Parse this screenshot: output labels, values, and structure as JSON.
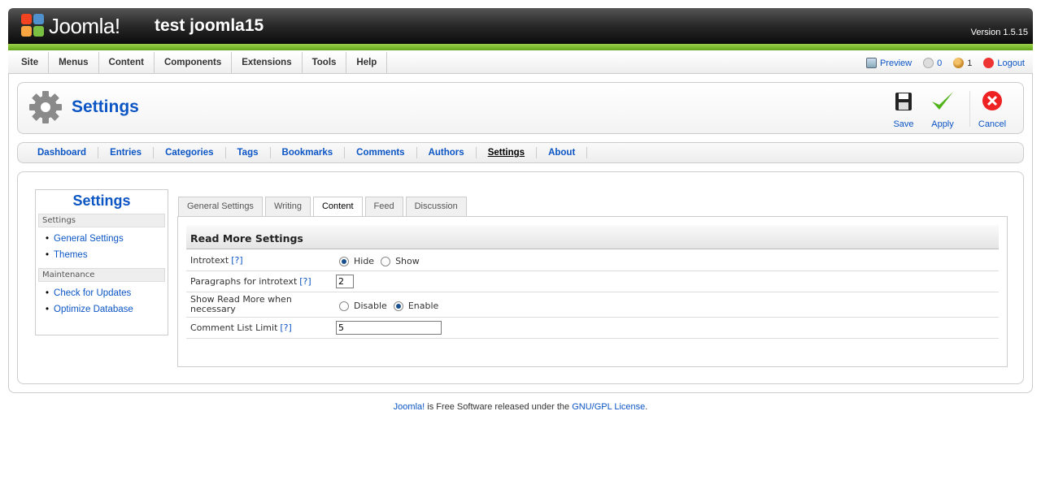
{
  "header": {
    "logo_text": "Joomla!",
    "site_name": "test joomla15",
    "version": "Version 1.5.15"
  },
  "menubar": {
    "items": [
      "Site",
      "Menus",
      "Content",
      "Components",
      "Extensions",
      "Tools",
      "Help"
    ],
    "preview": "Preview",
    "messages_count": "0",
    "users_count": "1",
    "logout": "Logout"
  },
  "toolbar": {
    "title": "Settings",
    "save": "Save",
    "apply": "Apply",
    "cancel": "Cancel"
  },
  "submenu": {
    "items": [
      "Dashboard",
      "Entries",
      "Categories",
      "Tags",
      "Bookmarks",
      "Comments",
      "Authors",
      "Settings",
      "About"
    ],
    "active": "Settings"
  },
  "sidebar": {
    "title": "Settings",
    "section1": "Settings",
    "links1": [
      "General Settings",
      "Themes"
    ],
    "section2": "Maintenance",
    "links2": [
      "Check for Updates",
      "Optimize Database"
    ]
  },
  "tabs": {
    "items": [
      "General Settings",
      "Writing",
      "Content",
      "Feed",
      "Discussion"
    ],
    "active": "Content"
  },
  "panel": {
    "heading": "Read More Settings",
    "help": "[?]",
    "introtext_label": "Introtext",
    "introtext_options": [
      "Hide",
      "Show"
    ],
    "introtext_value": "Hide",
    "paragraphs_label": "Paragraphs for introtext",
    "paragraphs_value": "2",
    "readmore_label": "Show Read More when necessary",
    "readmore_options": [
      "Disable",
      "Enable"
    ],
    "readmore_value": "Enable",
    "comment_limit_label": "Comment List Limit",
    "comment_limit_value": "5"
  },
  "footer": {
    "link1": "Joomla!",
    "text": " is Free Software released under the ",
    "link2": "GNU/GPL License",
    "end": "."
  },
  "colors": {
    "link": "#0b55c4",
    "header_green": "#7cbd2e"
  }
}
